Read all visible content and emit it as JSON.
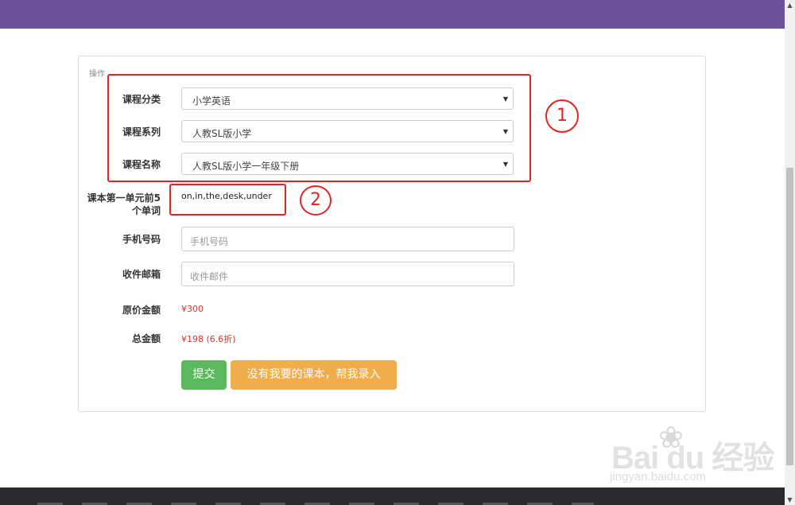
{
  "panel": {
    "legend": "操作"
  },
  "form": {
    "course_category": {
      "label": "课程分类",
      "value": "小学英语"
    },
    "course_series": {
      "label": "课程系列",
      "value": "人教SL版小学"
    },
    "course_name": {
      "label": "课程名称",
      "value": "人教SL版小学一年级下册"
    },
    "first_unit_words": {
      "label_line1": "课本第一单元前5",
      "label_line2": "个单词",
      "value": "on,in,the,desk,under"
    },
    "phone": {
      "label": "手机号码",
      "placeholder": "手机号码"
    },
    "email": {
      "label": "收件邮箱",
      "placeholder": "收件邮件"
    },
    "original_price": {
      "label": "原价金额",
      "value": "¥300"
    },
    "total_price": {
      "label": "总金额",
      "value": "¥198 (6.6折)"
    }
  },
  "buttons": {
    "submit": "提交",
    "request_textbook": "没有我要的课本，帮我录入"
  },
  "annotations": {
    "marker1": "1",
    "marker2": "2"
  },
  "watermark": {
    "logo": "Bai  du 经验",
    "url": "jingyan.baidu.com"
  },
  "colors": {
    "header": "#6b5198",
    "footer": "#2a2a2e",
    "submit": "#5cb85c",
    "request": "#f0ad4e",
    "price": "#d9342b",
    "annotation": "#e52421"
  }
}
